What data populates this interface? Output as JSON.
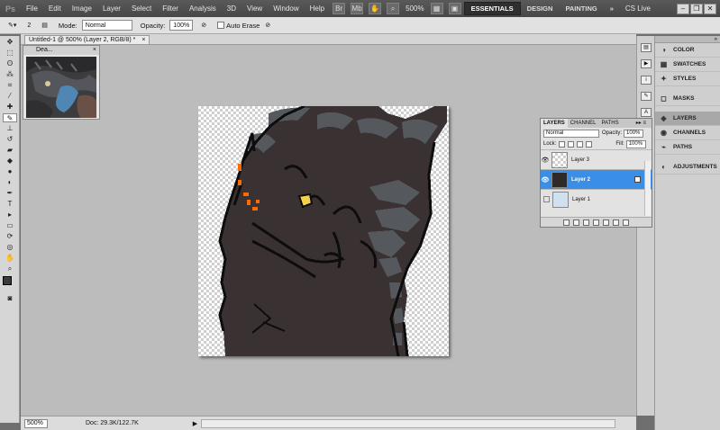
{
  "menubar": {
    "logo": "Ps",
    "items": [
      "File",
      "Edit",
      "Image",
      "Layer",
      "Select",
      "Filter",
      "Analysis",
      "3D",
      "View",
      "Window",
      "Help"
    ],
    "zoom": "500%",
    "workspaces": [
      "ESSENTIALS",
      "DESIGN",
      "PAINTING"
    ],
    "more": "»",
    "cs_live": "CS Live"
  },
  "options": {
    "brush_size": "2",
    "mode_label": "Mode:",
    "mode_value": "Normal",
    "opacity_label": "Opacity:",
    "opacity_value": "100%",
    "auto_erase": "Auto Erase"
  },
  "document": {
    "tab_title": "Untitled-1 @ 500% (Layer 2, RGB/8) *",
    "close": "×"
  },
  "navigator": {
    "title": "Dea...",
    "close": "×"
  },
  "status": {
    "zoom": "500%",
    "doc": "Doc: 29.3K/122.7K",
    "arrow": "▶"
  },
  "panel_dock": {
    "collapse": "»",
    "items": [
      {
        "label": "COLOR",
        "icon": "color-icon"
      },
      {
        "label": "SWATCHES",
        "icon": "swatches-icon"
      },
      {
        "label": "STYLES",
        "icon": "styles-icon"
      },
      {
        "label": "MASKS",
        "icon": "masks-icon"
      },
      {
        "label": "LAYERS",
        "icon": "layers-icon"
      },
      {
        "label": "CHANNELS",
        "icon": "channels-icon"
      },
      {
        "label": "PATHS",
        "icon": "paths-icon"
      },
      {
        "label": "ADJUSTMENTS",
        "icon": "adjustments-icon"
      }
    ]
  },
  "layers": {
    "tabs": [
      "LAYERS",
      "CHANNEL",
      "PATHS"
    ],
    "tab_controls": "▸▸ ≡",
    "blend_mode": "Normal",
    "opacity_label": "Opacity:",
    "opacity_value": "100%",
    "lock_label": "Lock:",
    "fill_label": "Fill:",
    "fill_value": "100%",
    "list": [
      {
        "name": "Layer 3",
        "visible": true,
        "selected": false
      },
      {
        "name": "Layer 2",
        "visible": true,
        "selected": true
      },
      {
        "name": "Layer 1",
        "visible": false,
        "selected": false
      }
    ]
  },
  "colors": {
    "selection": "#3a8ee6",
    "dragon_body": "#3a3232",
    "dragon_plates": "#55595e",
    "outline": "#0d0d0d",
    "eye": "#f4d14b",
    "ember": "#ff6a00"
  }
}
